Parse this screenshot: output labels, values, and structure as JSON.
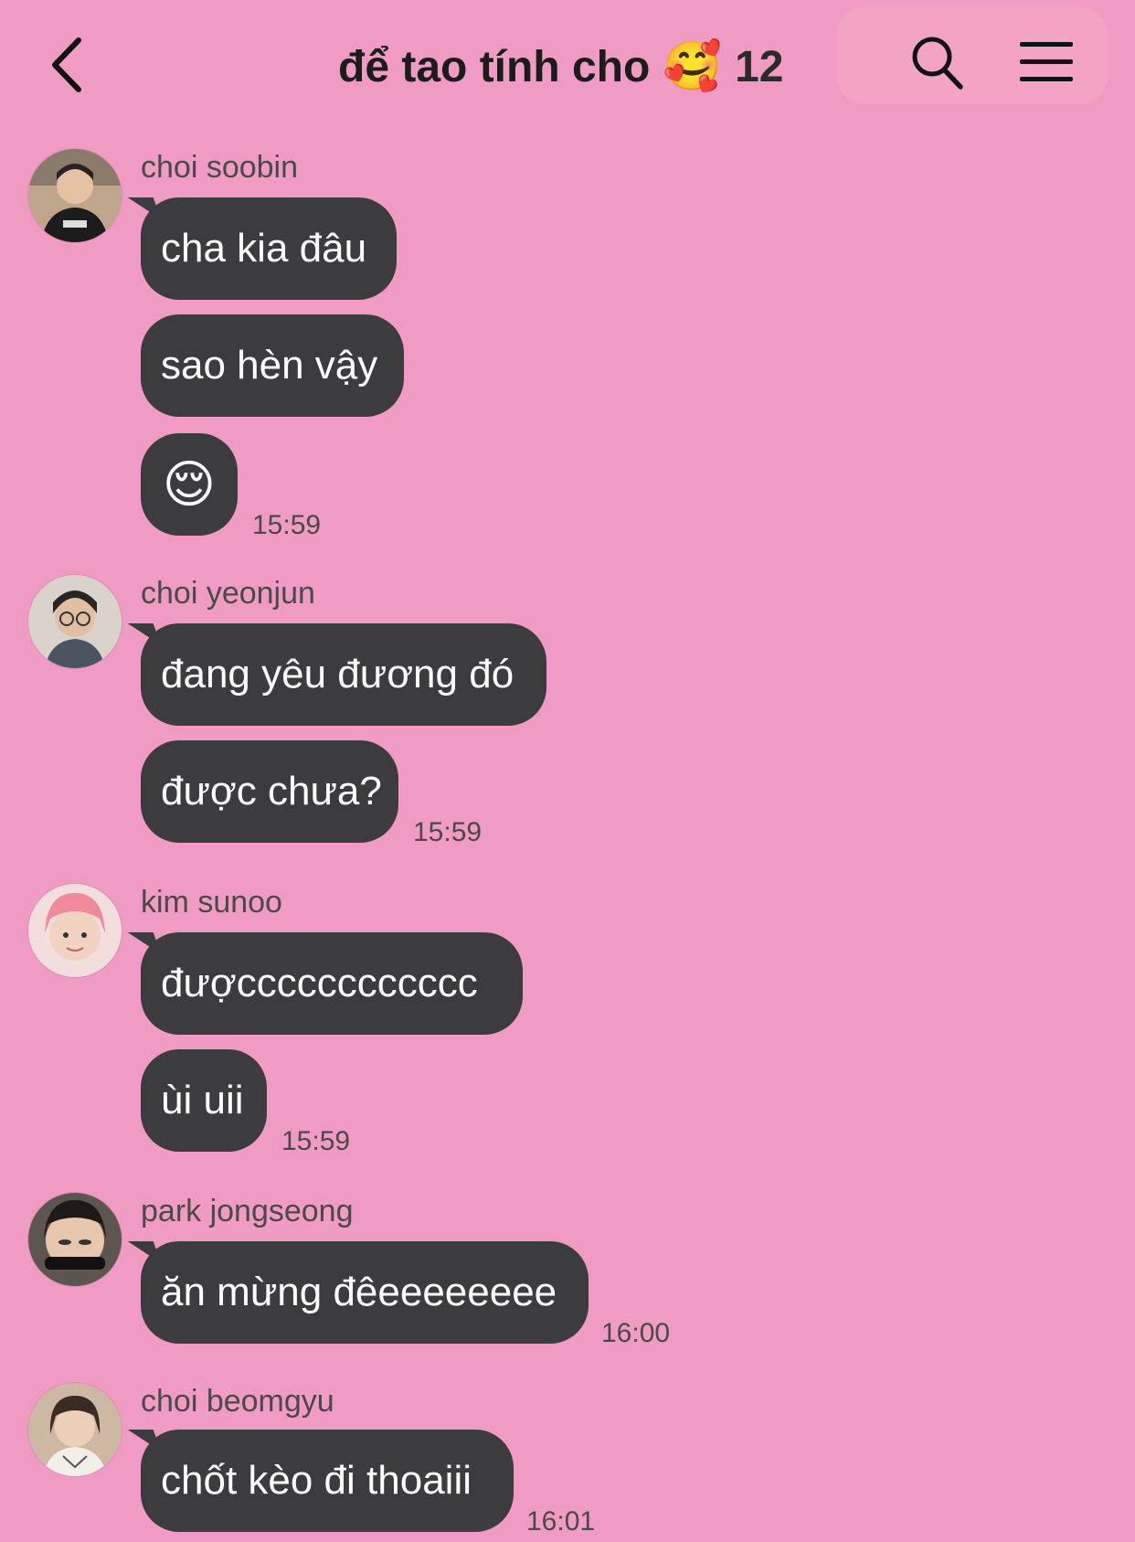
{
  "header": {
    "title": "để tao tính cho",
    "title_emoji": "🥰",
    "member_count": "12"
  },
  "colors": {
    "background": "#f09bc3",
    "bubble": "#3c3c3e",
    "bubble_text": "#ffffff",
    "meta_text": "#4a4a4a"
  },
  "messages": [
    {
      "sender": "choi soobin",
      "avatar": "avatar-soobin",
      "bubbles": [
        "cha kia đâu",
        "sao hèn vậy",
        "😌"
      ],
      "time": "15:59"
    },
    {
      "sender": "choi yeonjun",
      "avatar": "avatar-yeonjun",
      "bubbles": [
        "đang yêu đương đó",
        "được chưa?"
      ],
      "time": "15:59"
    },
    {
      "sender": "kim sunoo",
      "avatar": "avatar-sunoo",
      "bubbles": [
        "đượcccccccccccc",
        "ùi uii"
      ],
      "time": "15:59"
    },
    {
      "sender": "park jongseong",
      "avatar": "avatar-jongseong",
      "bubbles": [
        "ăn mừng đêeeeeeeee"
      ],
      "time": "16:00"
    },
    {
      "sender": "choi beomgyu",
      "avatar": "avatar-beomgyu",
      "bubbles": [
        "chốt kèo đi thoaiii"
      ],
      "time": "16:01"
    }
  ]
}
